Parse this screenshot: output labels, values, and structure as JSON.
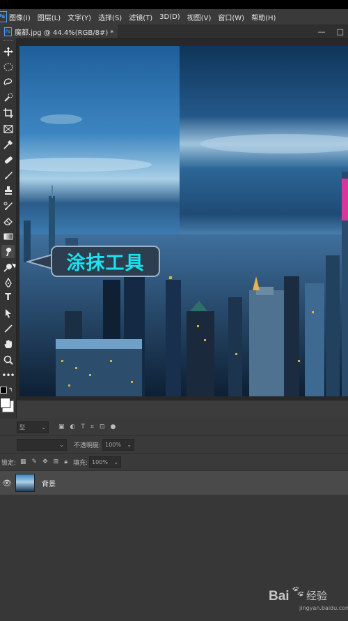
{
  "menubar": {
    "items": [
      "图像(I)",
      "图层(L)",
      "文字(Y)",
      "选择(S)",
      "滤镜(T)",
      "3D(D)",
      "视图(V)",
      "窗口(W)",
      "帮助(H)"
    ]
  },
  "document_tab": {
    "title": "魔都.jpg @ 44.4%(RGB/8#) *"
  },
  "window_controls": {
    "minimize": "—",
    "restore": "□"
  },
  "tools": [
    {
      "name": "move-tool-icon"
    },
    {
      "name": "marquee-tool-icon"
    },
    {
      "name": "lasso-tool-icon"
    },
    {
      "name": "quick-select-tool-icon"
    },
    {
      "name": "crop-tool-icon"
    },
    {
      "name": "frame-tool-icon"
    },
    {
      "name": "eyedropper-tool-icon"
    },
    {
      "name": "healing-brush-tool-icon"
    },
    {
      "name": "brush-tool-icon"
    },
    {
      "name": "clone-stamp-tool-icon"
    },
    {
      "name": "history-brush-tool-icon"
    },
    {
      "name": "eraser-tool-icon"
    },
    {
      "name": "gradient-tool-icon"
    },
    {
      "name": "smudge-tool-icon"
    },
    {
      "name": "dodge-tool-icon"
    },
    {
      "name": "pen-tool-icon"
    },
    {
      "name": "type-tool-icon"
    },
    {
      "name": "path-select-tool-icon"
    },
    {
      "name": "line-tool-icon"
    },
    {
      "name": "hand-tool-icon"
    },
    {
      "name": "zoom-tool-icon"
    },
    {
      "name": "more-tools-icon"
    }
  ],
  "callout": {
    "text": "涂抹工具"
  },
  "layers_panel": {
    "kind_filter": "型",
    "opacity_label": "不透明度:",
    "opacity_value": "100%",
    "lock_label": "锁定:",
    "fill_label": "填充:",
    "fill_value": "100%",
    "layers": [
      {
        "name": "背景",
        "visible": true
      }
    ]
  },
  "watermark": {
    "brand": "Bai",
    "brand2": "经验",
    "url": "jingyan.baidu.com"
  },
  "colors": {
    "callout_text": "#19e3f0",
    "accent": "#4aa3ff"
  }
}
